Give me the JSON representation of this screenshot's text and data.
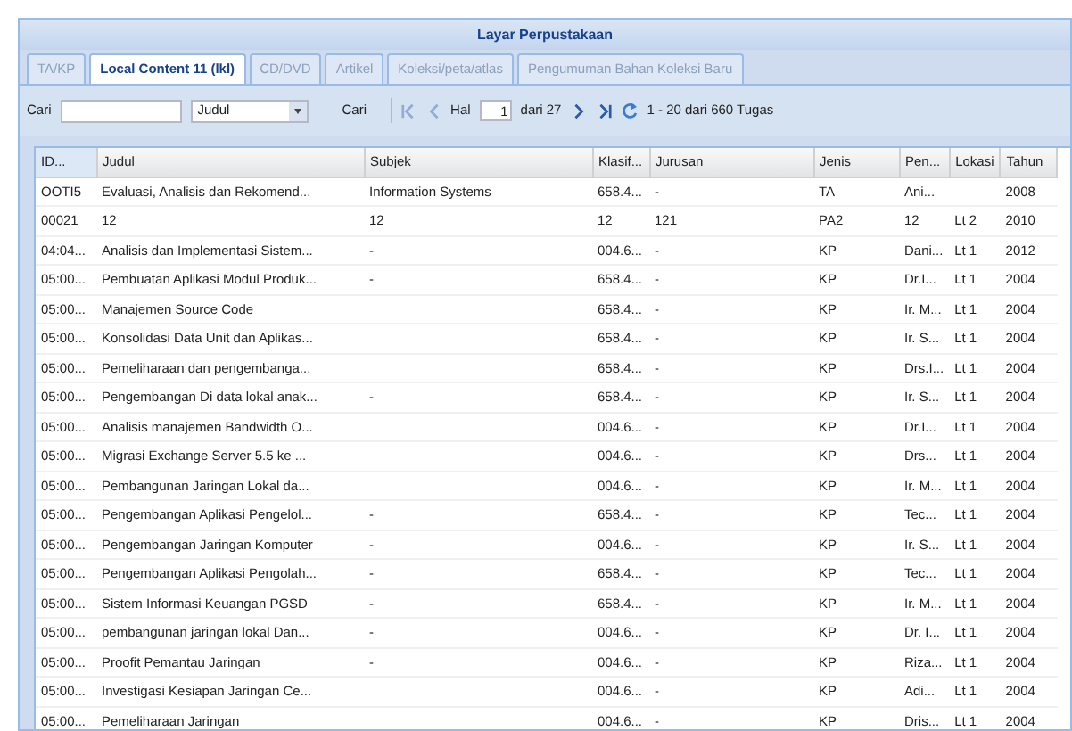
{
  "window": {
    "title": "Layar Perpustakaan"
  },
  "tabs": [
    {
      "label": "TA/KP",
      "selected": false
    },
    {
      "label": "Local Content 11 (lkl)",
      "selected": true
    },
    {
      "label": "CD/DVD",
      "selected": false
    },
    {
      "label": "Artikel",
      "selected": false
    },
    {
      "label": "Koleksi/peta/atlas",
      "selected": false
    },
    {
      "label": "Pengumuman Bahan Koleksi Baru",
      "selected": false
    }
  ],
  "toolbar": {
    "search_label": "Cari",
    "field_select": "Judul",
    "search_button": "Cari",
    "page_label": "Hal",
    "page_value": "1",
    "page_total": "dari 27",
    "summary": "1 - 20 dari 660 Tugas"
  },
  "table": {
    "columns": [
      "ID...",
      "Judul",
      "Subjek",
      "Klasif...",
      "Jurusan",
      "Jenis",
      "Pen...",
      "Lokasi",
      "Tahun"
    ],
    "rows": [
      [
        "OOTI5",
        "Evaluasi, Analisis dan Rekomend...",
        "Information Systems",
        "658.4...",
        "-",
        "TA",
        "Ani...",
        "",
        "2008"
      ],
      [
        "00021",
        "12",
        "12",
        "12",
        "121",
        "PA2",
        "12",
        "Lt 2",
        "2010"
      ],
      [
        "04:04...",
        "Analisis dan Implementasi Sistem...",
        "-",
        "004.6...",
        "-",
        "KP",
        "Dani...",
        "Lt 1",
        "2012"
      ],
      [
        "05:00...",
        "Pembuatan Aplikasi Modul Produk...",
        "-",
        "658.4...",
        "-",
        "KP",
        "Dr.I...",
        "Lt 1",
        "2004"
      ],
      [
        "05:00...",
        "Manajemen Source Code",
        "",
        "658.4...",
        "-",
        "KP",
        "Ir. M...",
        "Lt 1",
        "2004"
      ],
      [
        "05:00...",
        "Konsolidasi Data Unit dan Aplikas...",
        "",
        "658.4...",
        "-",
        "KP",
        "Ir. S...",
        "Lt 1",
        "2004"
      ],
      [
        "05:00...",
        "Pemeliharaan dan pengembanga...",
        "",
        "658.4...",
        "-",
        "KP",
        "Drs.I...",
        "Lt 1",
        "2004"
      ],
      [
        "05:00...",
        "Pengembangan Di data lokal anak...",
        "-",
        "658.4...",
        "-",
        "KP",
        "Ir. S...",
        "Lt 1",
        "2004"
      ],
      [
        "05:00...",
        "Analisis manajemen Bandwidth O...",
        "",
        "004.6...",
        "-",
        "KP",
        "Dr.I...",
        "Lt 1",
        "2004"
      ],
      [
        "05:00...",
        "Migrasi Exchange Server 5.5 ke ...",
        "",
        "004.6...",
        "-",
        "KP",
        "Drs...",
        "Lt 1",
        "2004"
      ],
      [
        "05:00...",
        "Pembangunan Jaringan Lokal da...",
        "",
        "004.6...",
        "-",
        "KP",
        "Ir. M...",
        "Lt 1",
        "2004"
      ],
      [
        "05:00...",
        "Pengembangan Aplikasi Pengelol...",
        "-",
        "658.4...",
        "-",
        "KP",
        "Tec...",
        "Lt 1",
        "2004"
      ],
      [
        "05:00...",
        "Pengembangan Jaringan Komputer",
        "-",
        "004.6...",
        "-",
        "KP",
        "Ir. S...",
        "Lt 1",
        "2004"
      ],
      [
        "05:00...",
        "Pengembangan Aplikasi Pengolah...",
        "-",
        "658.4...",
        "-",
        "KP",
        "Tec...",
        "Lt 1",
        "2004"
      ],
      [
        "05:00...",
        "Sistem Informasi Keuangan PGSD",
        "-",
        "658.4...",
        "-",
        "KP",
        "Ir. M...",
        "Lt 1",
        "2004"
      ],
      [
        "05:00...",
        "pembangunan jaringan lokal Dan...",
        "-",
        "004.6...",
        "-",
        "KP",
        "Dr. I...",
        "Lt 1",
        "2004"
      ],
      [
        "05:00...",
        "Proofit Pemantau Jaringan",
        "-",
        "004.6...",
        "-",
        "KP",
        "Riza...",
        "Lt 1",
        "2004"
      ],
      [
        "05:00...",
        "Investigasi Kesiapan Jaringan Ce...",
        "",
        "004.6...",
        "-",
        "KP",
        "Adi...",
        "Lt 1",
        "2004"
      ],
      [
        "05:00...",
        "Pemeliharaan Jaringan",
        "",
        "004.6...",
        "-",
        "KP",
        "Dris...",
        "Lt 1",
        "2004"
      ]
    ]
  }
}
